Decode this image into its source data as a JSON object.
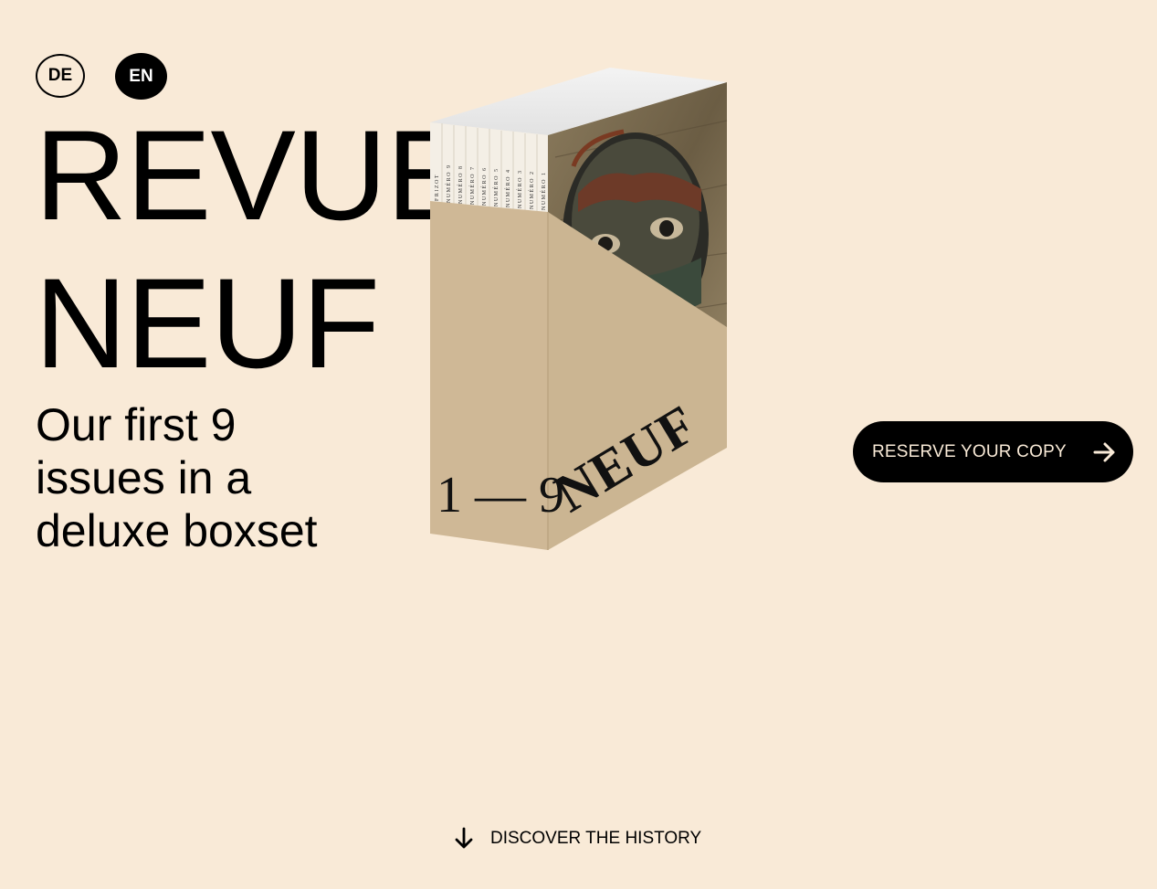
{
  "lang_switch": {
    "de": "DE",
    "en": "EN",
    "active": "EN"
  },
  "hero": {
    "title_line1": "REVUE",
    "title_line2": "NEUF",
    "subtitle": "Our first 9 issues in a deluxe boxset"
  },
  "boxset": {
    "front_label": "1 — 9",
    "side_label": "NEUF",
    "spines": [
      "FRIZOT",
      "NUMÉRO 9",
      "NUMÉRO 8",
      "NUMÉRO 7",
      "NUMÉRO 6",
      "NUMÉRO 5",
      "NUMÉRO 4",
      "NUMÉRO 3",
      "NUMÉRO 2",
      "NUMÉRO 1"
    ]
  },
  "cta": {
    "reserve_label": "RESERVE YOUR COPY",
    "icon": "arrow-right-icon"
  },
  "footer": {
    "discover_label": "DISCOVER THE HISTORY",
    "icon": "arrow-down-icon"
  },
  "colors": {
    "background": "#f9ead7",
    "box": "#cfb896",
    "button": "#000000"
  }
}
